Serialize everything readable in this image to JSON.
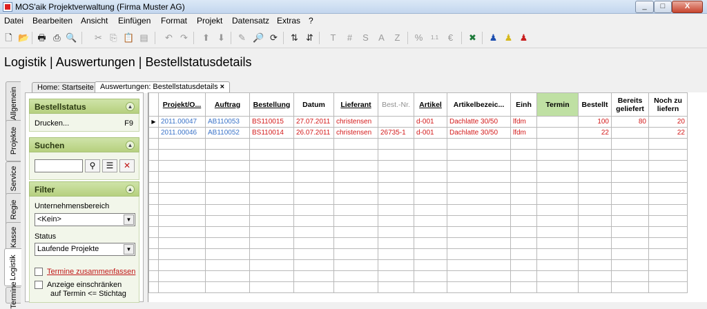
{
  "window": {
    "title": "MOS'aik Projektverwaltung (Firma Muster AG)"
  },
  "menu": [
    "Datei",
    "Bearbeiten",
    "Ansicht",
    "Einfügen",
    "Format",
    "Projekt",
    "Datensatz",
    "Extras",
    "?"
  ],
  "toolbar": {
    "icons": [
      "new-icon",
      "open-icon",
      "print-icon",
      "print-preview-icon",
      "preview-icon",
      "cut-icon",
      "copy-icon",
      "paste-icon",
      "clipboard-icon",
      "undo-icon",
      "redo-icon",
      "move-up-icon",
      "move-down-icon",
      "edit-icon",
      "find-icon",
      "refresh-icon",
      "sort-asc-icon",
      "sort-desc-icon",
      "text-icon",
      "number-icon",
      "s-icon",
      "a-icon",
      "z-icon",
      "percent-icon",
      "decimal-icon",
      "currency-icon",
      "excel-icon",
      "user-blue-icon",
      "user-yellow-icon",
      "user-red-icon"
    ]
  },
  "header": {
    "title": "Logistik | Auswertungen | Bestellstatusdetails"
  },
  "side_tabs": [
    "Allgemein",
    "Projekte",
    "Service",
    "Regie",
    "Kasse",
    "Logistik",
    "Termine"
  ],
  "doc_tabs": [
    "Home: Startseite",
    "Auswertungen: Bestellstatusdetails"
  ],
  "doc_tab_close": "×",
  "sidebar": {
    "bestellstatus": {
      "title": "Bestellstatus",
      "print_label": "Drucken...",
      "print_key": "F9"
    },
    "suchen": {
      "title": "Suchen",
      "value": ""
    },
    "filter": {
      "title": "Filter",
      "unternehmensbereich_label": "Unternehmensbereich",
      "unternehmensbereich_value": "<Kein>",
      "status_label": "Status",
      "status_value": "Laufende Projekte",
      "termine_label": "Termine zusammenfassen",
      "anzeige_label_1": "Anzeige einschränken",
      "anzeige_label_2": "auf Termin <= Stichtag"
    }
  },
  "table": {
    "columns": [
      "Projekt/O...",
      "Auftrag",
      "Bestellung",
      "Datum",
      "Lieferant",
      "Best.-Nr.",
      "Artikel",
      "Artikelbezeic...",
      "Einh",
      "Termin",
      "Bestellt",
      "Bereits geliefert",
      "Noch zu liefern"
    ],
    "rows": [
      [
        "2011.00047",
        "AB110053",
        "BS110015",
        "27.07.2011",
        "christensen",
        "",
        "d-001",
        "Dachlatte 30/50",
        "lfdm",
        "",
        "100",
        "80",
        "20"
      ],
      [
        "2011.00046",
        "AB110052",
        "BS110014",
        "26.07.2011",
        "christensen",
        "26735-1",
        "d-001",
        "Dachlatte 30/50",
        "lfdm",
        "",
        "22",
        "",
        "22"
      ]
    ],
    "current_row_marker": "▶"
  },
  "colors": {
    "panel_header": "#b6d07f",
    "termin_header": "#bfe0a3",
    "data_red": "#d31919",
    "data_blue": "#3a73c8"
  }
}
